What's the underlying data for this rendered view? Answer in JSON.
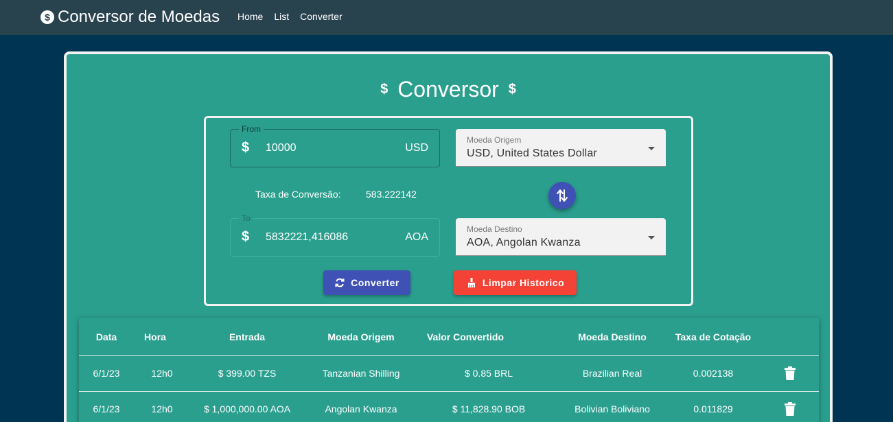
{
  "navbar": {
    "brand_icon": "$",
    "title": "Conversor de Moedas",
    "links": [
      "Home",
      "List",
      "Converter"
    ]
  },
  "converter": {
    "title": "Conversor",
    "title_icon": "$",
    "from": {
      "legend": "From",
      "prefix": "$",
      "value": "10000",
      "currency": "USD"
    },
    "to": {
      "legend": "To",
      "prefix": "$",
      "value": "5832221,416086",
      "currency": "AOA"
    },
    "origin_select": {
      "label": "Moeda Origem",
      "value": "USD, United States Dollar"
    },
    "dest_select": {
      "label": "Moeda Destino",
      "value": "AOA, Angolan Kwanza"
    },
    "rate_label": "Taxa de Conversão:",
    "rate_value": "583.222142",
    "convert_label": "Converter",
    "clear_label": "Limpar Historico"
  },
  "history": {
    "headers": [
      "Data",
      "Hora",
      "Entrada",
      "Moeda Origem",
      "Valor Convertido",
      "Moeda Destino",
      "Taxa de Cotação"
    ],
    "rows": [
      [
        "6/1/23",
        "12h0",
        "$ 399.00 TZS",
        "Tanzanian Shilling",
        "$ 0.85 BRL",
        "Brazilian Real",
        "0.002138"
      ],
      [
        "6/1/23",
        "12h0",
        "$ 1,000,000.00 AOA",
        "Angolan Kwanza",
        "$ 11,828.90 BOB",
        "Bolivian Boliviano",
        "0.011829"
      ]
    ]
  },
  "colors": {
    "navbar": "#29434e",
    "background": "#003453",
    "card": "#2b9f8e",
    "primary": "#3f51b5",
    "danger": "#f44336"
  },
  "icons": {
    "brand": "dollar-circle-icon",
    "swap": "swap-vertical-icon",
    "convert": "refresh-icon",
    "clear": "broom-icon",
    "delete": "trash-icon"
  }
}
